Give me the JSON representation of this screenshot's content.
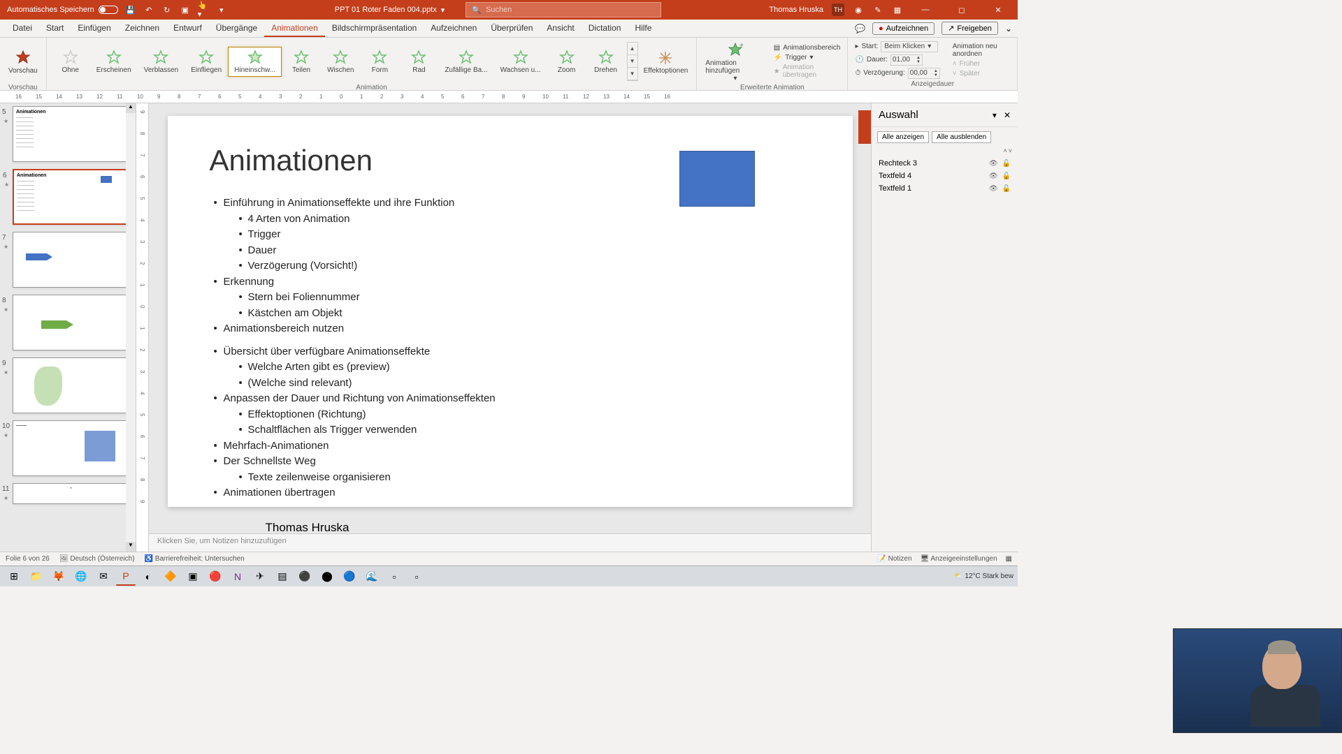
{
  "titlebar": {
    "autosave": "Automatisches Speichern",
    "filename": "PPT 01 Roter Faden 004.pptx",
    "search_placeholder": "Suchen",
    "username": "Thomas Hruska",
    "user_initials": "TH"
  },
  "menu": {
    "tabs": [
      "Datei",
      "Start",
      "Einfügen",
      "Zeichnen",
      "Entwurf",
      "Übergänge",
      "Animationen",
      "Bildschirmpräsentation",
      "Aufzeichnen",
      "Überprüfen",
      "Ansicht",
      "Dictation",
      "Hilfe"
    ],
    "active": "Animationen",
    "record": "Aufzeichnen",
    "share": "Freigeben"
  },
  "ribbon": {
    "preview": "Vorschau",
    "anims": [
      "Ohne",
      "Erscheinen",
      "Verblassen",
      "Einfliegen",
      "Hineinschw...",
      "Teilen",
      "Wischen",
      "Form",
      "Rad",
      "Zufällige Ba...",
      "Wachsen u...",
      "Zoom",
      "Drehen"
    ],
    "selected_anim": 4,
    "effect_options": "Effektoptionen",
    "group_anim": "Animation",
    "add_anim": "Animation hinzufügen",
    "anim_pane": "Animationsbereich",
    "trigger": "Trigger",
    "painter": "Animation übertragen",
    "group_ext": "Erweiterte Animation",
    "start_label": "Start:",
    "start_value": "Beim Klicken",
    "duration_label": "Dauer:",
    "duration_value": "01,00",
    "delay_label": "Verzögerung:",
    "delay_value": "00,00",
    "reorder": "Animation neu anordnen",
    "earlier": "Früher",
    "later": "Später",
    "group_timing": "Anzeigedauer"
  },
  "ruler_marks": [
    "16",
    "15",
    "14",
    "13",
    "12",
    "11",
    "10",
    "9",
    "8",
    "7",
    "6",
    "5",
    "4",
    "3",
    "2",
    "1",
    "0",
    "1",
    "2",
    "3",
    "4",
    "5",
    "6",
    "7",
    "8",
    "9",
    "10",
    "11",
    "12",
    "13",
    "14",
    "15",
    "16"
  ],
  "ruler_v": [
    "9",
    "8",
    "7",
    "6",
    "5",
    "4",
    "3",
    "2",
    "1",
    "0",
    "1",
    "2",
    "3",
    "4",
    "5",
    "6",
    "7",
    "8",
    "9"
  ],
  "thumbs": [
    {
      "num": "5",
      "title": "Animationen"
    },
    {
      "num": "6",
      "title": "Animationen",
      "selected": true
    },
    {
      "num": "7",
      "title": ""
    },
    {
      "num": "8",
      "title": ""
    },
    {
      "num": "9",
      "title": ""
    },
    {
      "num": "10",
      "title": ""
    },
    {
      "num": "11",
      "title": ""
    }
  ],
  "slide": {
    "title": "Animationen",
    "bullets": [
      {
        "lvl": 1,
        "t": "Einführung in Animationseffekte und ihre Funktion"
      },
      {
        "lvl": 2,
        "t": "4 Arten von Animation"
      },
      {
        "lvl": 2,
        "t": "Trigger"
      },
      {
        "lvl": 2,
        "t": "Dauer"
      },
      {
        "lvl": 2,
        "t": "Verzögerung (Vorsicht!)"
      },
      {
        "lvl": 1,
        "t": "Erkennung"
      },
      {
        "lvl": 2,
        "t": "Stern bei Foliennummer"
      },
      {
        "lvl": 2,
        "t": "Kästchen am Objekt"
      },
      {
        "lvl": 1,
        "t": "Animationsbereich nutzen"
      },
      {
        "lvl": 0,
        "t": ""
      },
      {
        "lvl": 1,
        "t": "Übersicht über verfügbare Animationseffekte"
      },
      {
        "lvl": 2,
        "t": "Welche Arten gibt es (preview)"
      },
      {
        "lvl": 2,
        "t": "(Welche sind relevant)"
      },
      {
        "lvl": 1,
        "t": "Anpassen der Dauer und Richtung von Animationseffekten"
      },
      {
        "lvl": 2,
        "t": "Effektoptionen (Richtung)"
      },
      {
        "lvl": 2,
        "t": "Schaltflächen als Trigger verwenden"
      },
      {
        "lvl": 1,
        "t": "Mehrfach-Animationen"
      },
      {
        "lvl": 1,
        "t": "Der Schnellste Weg"
      },
      {
        "lvl": 2,
        "t": "Texte zeilenweise organisieren"
      },
      {
        "lvl": 1,
        "t": "Animationen übertragen"
      }
    ],
    "author": "Thomas Hruska"
  },
  "notes_placeholder": "Klicken Sie, um Notizen hinzuzufügen",
  "selection": {
    "title": "Auswahl",
    "show_all": "Alle anzeigen",
    "hide_all": "Alle ausblenden",
    "items": [
      "Rechteck 3",
      "Textfeld 4",
      "Textfeld 1"
    ]
  },
  "status": {
    "slide": "Folie 6 von 26",
    "lang": "Deutsch (Österreich)",
    "access": "Barrierefreiheit: Untersuchen",
    "notes": "Notizen",
    "display": "Anzeigeeinstellungen"
  },
  "taskbar": {
    "temp": "12°C",
    "weather": "Stark bew"
  }
}
